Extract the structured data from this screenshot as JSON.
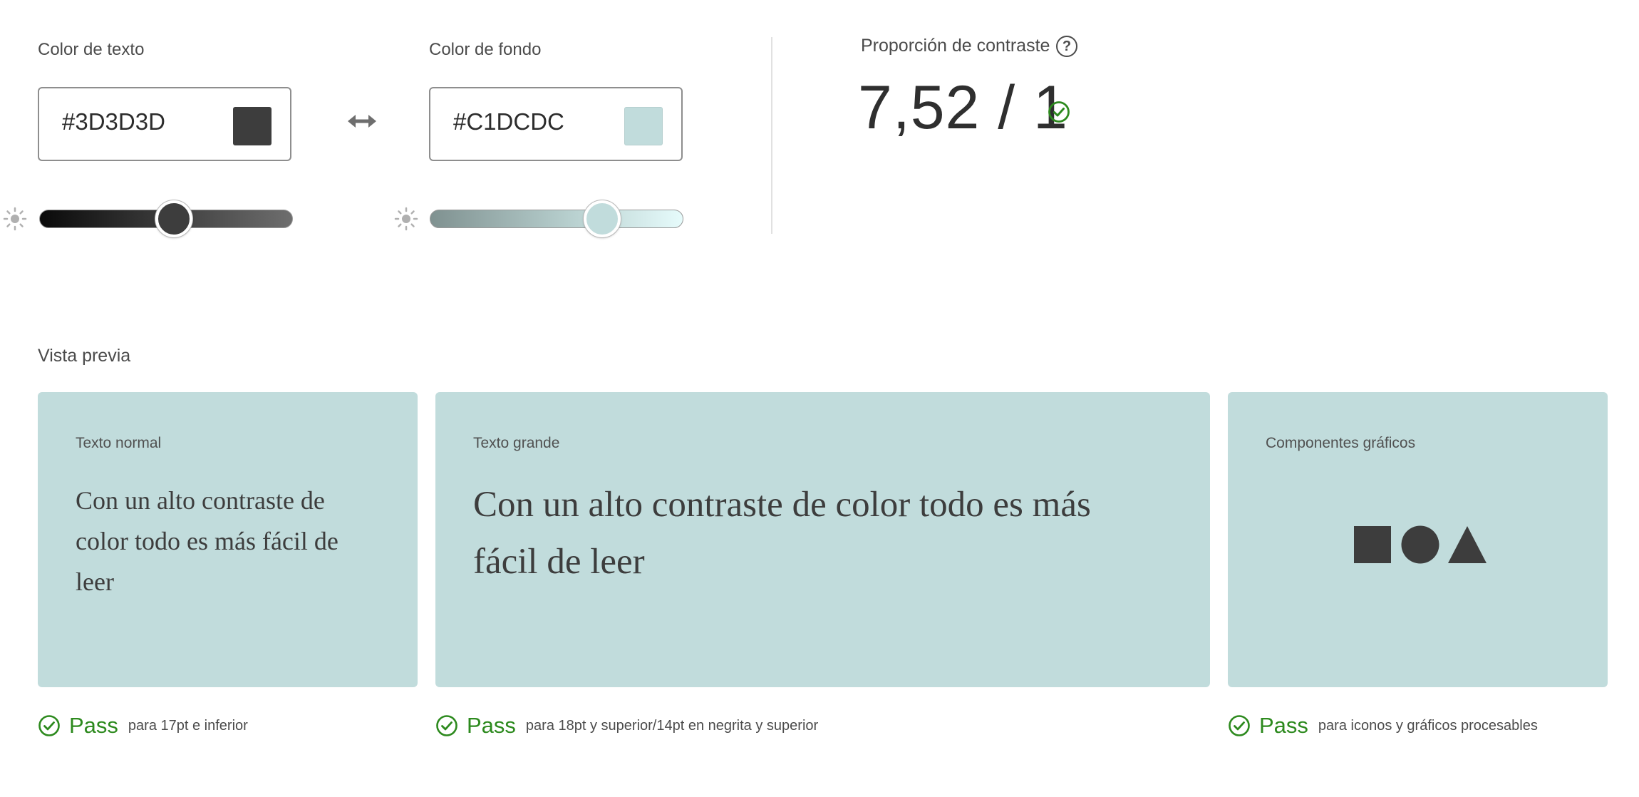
{
  "text_color": {
    "label": "Color de texto",
    "hex_value": "#3D3D3D",
    "swatch_color": "#3D3D3D",
    "slider_level": 0.53
  },
  "swap_icon": "swap-horizontal-icon",
  "background_color": {
    "label": "Color de fondo",
    "hex_value": "#C1DCDC",
    "swatch_color": "#C1DCDC",
    "slider_level": 0.68
  },
  "contrast": {
    "label": "Proporción de contraste",
    "help_glyph": "?",
    "ratio": "7,52 / 1",
    "status_icon": "check-circle-icon"
  },
  "preview": {
    "title": "Vista previa",
    "cards": [
      {
        "label": "Texto normal",
        "sample": "Con un alto contraste de color todo es más fácil de leer"
      },
      {
        "label": "Texto grande",
        "sample": "Con un alto contraste de color todo es más fácil de leer"
      },
      {
        "label": "Componentes gráficos",
        "shapes": [
          "square-shape",
          "circle-shape",
          "triangle-shape"
        ]
      }
    ]
  },
  "results": [
    {
      "status": "Pass",
      "description": "para 17pt e inferior"
    },
    {
      "status": "Pass",
      "description": "para 18pt y superior/14pt en negrita y superior"
    },
    {
      "status": "Pass",
      "description": "para iconos y gráficos procesables"
    }
  ],
  "colors": {
    "pass_green": "#2D8A1E",
    "preview_background": "#C1DCDC",
    "preview_foreground": "#3D3D3D"
  }
}
